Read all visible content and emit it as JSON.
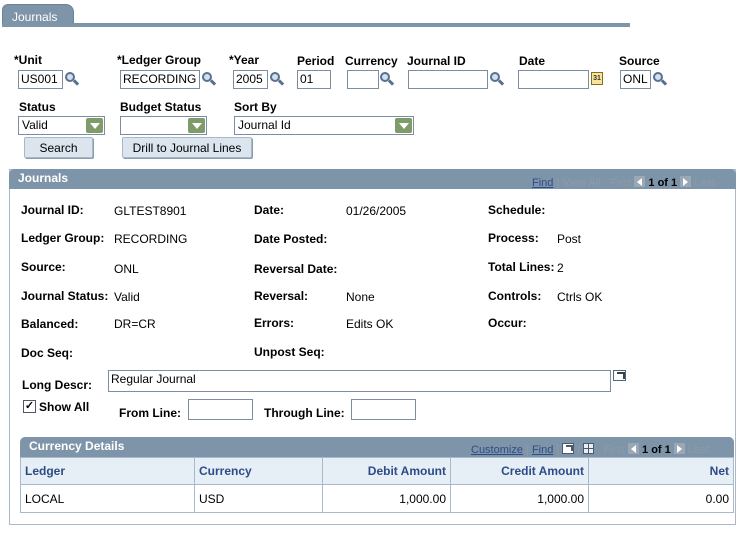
{
  "page_tab": "Journals",
  "search": {
    "unit": {
      "label": "*Unit",
      "value": "US001"
    },
    "ledger_group": {
      "label": "*Ledger Group",
      "value": "RECORDING"
    },
    "year": {
      "label": "*Year",
      "value": "2005"
    },
    "period": {
      "label": "Period",
      "value": "01"
    },
    "currency": {
      "label": "Currency",
      "value": ""
    },
    "journal_id": {
      "label": "Journal ID",
      "value": ""
    },
    "date": {
      "label": "Date",
      "value": ""
    },
    "calendar_glyph": "31",
    "source": {
      "label": "Source",
      "value": "ONL"
    },
    "status": {
      "label": "Status",
      "value": "Valid"
    },
    "budget_status": {
      "label": "Budget Status",
      "value": ""
    },
    "sort_by": {
      "label": "Sort By",
      "value": "Journal Id"
    },
    "search_button": "Search",
    "drill_button": "Drill to Journal Lines"
  },
  "journals_box": {
    "title": "Journals",
    "nav": {
      "find": "Find",
      "sep": "|",
      "view_all": "View All",
      "first": "First",
      "count": "1 of 1",
      "last": "Last"
    },
    "fields": {
      "journal_id": {
        "label": "Journal ID:",
        "value": "GLTEST8901"
      },
      "date": {
        "label": "Date:",
        "value": "01/26/2005"
      },
      "schedule": {
        "label": "Schedule:",
        "value": ""
      },
      "ledger_group": {
        "label": "Ledger Group:",
        "value": "RECORDING"
      },
      "date_posted": {
        "label": "Date Posted:",
        "value": ""
      },
      "process": {
        "label": "Process:",
        "value": "Post"
      },
      "source": {
        "label": "Source:",
        "value": "ONL"
      },
      "reversal_date": {
        "label": "Reversal Date:",
        "value": ""
      },
      "total_lines": {
        "label": "Total Lines:",
        "value": "2"
      },
      "journal_status": {
        "label": "Journal Status:",
        "value": "Valid"
      },
      "reversal": {
        "label": "Reversal:",
        "value": "None"
      },
      "controls": {
        "label": "Controls:",
        "value": "Ctrls OK"
      },
      "balanced": {
        "label": "Balanced:",
        "value": "DR=CR"
      },
      "errors": {
        "label": "Errors:",
        "value": "Edits OK"
      },
      "occur": {
        "label": "Occur:",
        "value": ""
      },
      "doc_seq": {
        "label": "Doc Seq:",
        "value": ""
      },
      "unpost_seq": {
        "label": "Unpost Seq:",
        "value": ""
      }
    },
    "long_descr": {
      "label": "Long Descr:",
      "value": "Regular Journal"
    },
    "show_all": {
      "label": "Show All",
      "checked": true,
      "mark": "✓"
    },
    "from_line": {
      "label": "From Line:",
      "value": ""
    },
    "through_line": {
      "label": "Through Line:",
      "value": ""
    }
  },
  "currency_details": {
    "title": "Currency Details",
    "nav": {
      "customize": "Customize",
      "find": "Find",
      "sep": "|",
      "first": "First",
      "count": "1 of 1",
      "last": "Last"
    },
    "columns": [
      "Ledger",
      "Currency",
      "Debit Amount",
      "Credit Amount",
      "Net"
    ],
    "rows": [
      [
        "LOCAL",
        "USD",
        "1,000.00",
        "1,000.00",
        "0.00"
      ]
    ]
  },
  "colors": {
    "header_bg": "#7e95a9",
    "link": "#2d4c87",
    "border": "#a9b9c9",
    "dropdown_arrow": "#7f9b69"
  }
}
